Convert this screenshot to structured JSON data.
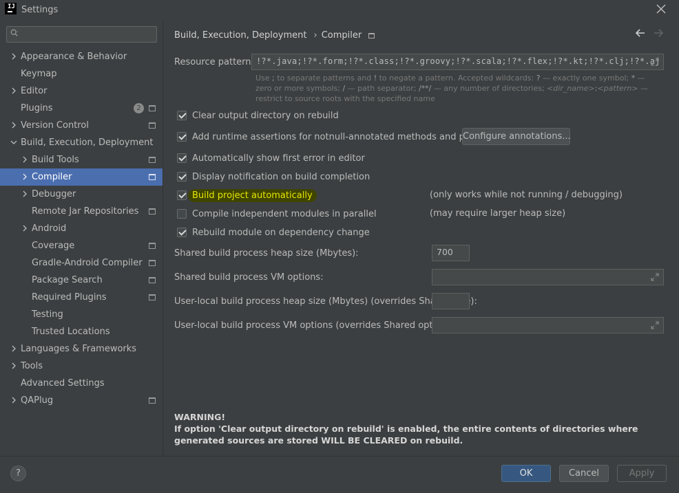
{
  "window": {
    "title": "Settings",
    "logo_text": "IJ"
  },
  "search": {
    "placeholder": "",
    "value": ""
  },
  "sidebar": {
    "items": [
      {
        "label": "Appearance & Behavior"
      },
      {
        "label": "Keymap"
      },
      {
        "label": "Editor"
      },
      {
        "label": "Plugins",
        "badge": "2"
      },
      {
        "label": "Version Control"
      },
      {
        "label": "Build, Execution, Deployment"
      },
      {
        "label": "Build Tools"
      },
      {
        "label": "Compiler"
      },
      {
        "label": "Debugger"
      },
      {
        "label": "Remote Jar Repositories"
      },
      {
        "label": "Android"
      },
      {
        "label": "Coverage"
      },
      {
        "label": "Gradle-Android Compiler"
      },
      {
        "label": "Package Search"
      },
      {
        "label": "Required Plugins"
      },
      {
        "label": "Testing"
      },
      {
        "label": "Trusted Locations"
      },
      {
        "label": "Languages & Frameworks"
      },
      {
        "label": "Tools"
      },
      {
        "label": "Advanced Settings"
      },
      {
        "label": "QAPlug"
      }
    ]
  },
  "breadcrumb": {
    "parent": "Build, Execution, Deployment",
    "current": "Compiler"
  },
  "resource_patterns": {
    "label": "Resource patterns:",
    "value": "!?*.java;!?*.form;!?*.class;!?*.groovy;!?*.scala;!?*.flex;!?*.kt;!?*.clj;!?*.aj",
    "hint_1": "Use ",
    "hint_semi": ";",
    "hint_2": " to separate patterns and ",
    "hint_bang": "!",
    "hint_3": " to negate a pattern. Accepted wildcards: ",
    "hint_q": "?",
    "hint_4": " — exactly one symbol; ",
    "hint_star": "*",
    "hint_5": " — zero or more symbols; ",
    "hint_slash": "/",
    "hint_6": " — path separator; ",
    "hint_dstar": "/**/",
    "hint_7": " — any number of directories; ",
    "hint_dir": "<dir_name>",
    "hint_colon": ":",
    "hint_pattern": "<pattern>",
    "hint_8": " — restrict to source roots with the specified name"
  },
  "options": {
    "clear_output": {
      "label": "Clear output directory on rebuild",
      "checked": true
    },
    "runtime_assertions": {
      "label": "Add runtime assertions for notnull-annotated methods and parameters",
      "checked": true
    },
    "configure_annotations": "Configure annotations...",
    "show_first_error": {
      "label": "Automatically show first error in editor",
      "checked": true
    },
    "display_notification": {
      "label": "Display notification on build completion",
      "checked": true
    },
    "build_automatically": {
      "label": "Build project automatically",
      "checked": true,
      "note": "(only works while not running / debugging)"
    },
    "compile_parallel": {
      "label": "Compile independent modules in parallel",
      "checked": false,
      "note": "(may require larger heap size)"
    },
    "rebuild_module": {
      "label": "Rebuild module on dependency change",
      "checked": true
    }
  },
  "heap": {
    "shared_heap_label": "Shared build process heap size (Mbytes):",
    "shared_heap_value": "700",
    "shared_vm_label": "Shared build process VM options:",
    "shared_vm_value": "",
    "local_heap_label": "User-local build process heap size (Mbytes) (overrides Shared size):",
    "local_heap_value": "",
    "local_vm_label": "User-local build process VM options (overrides Shared options):",
    "local_vm_value": ""
  },
  "warning": {
    "title": "WARNING!",
    "text": "If option 'Clear output directory on rebuild' is enabled, the entire contents of directories where generated sources are stored WILL BE CLEARED on rebuild."
  },
  "footer": {
    "help": "?",
    "ok": "OK",
    "cancel": "Cancel",
    "apply": "Apply"
  },
  "colors": {
    "background": "#3c3f41",
    "selection": "#4b6eaf",
    "primary_button": "#365880",
    "highlight_bg": "#3f4400",
    "highlight_fg": "#e6e600"
  }
}
